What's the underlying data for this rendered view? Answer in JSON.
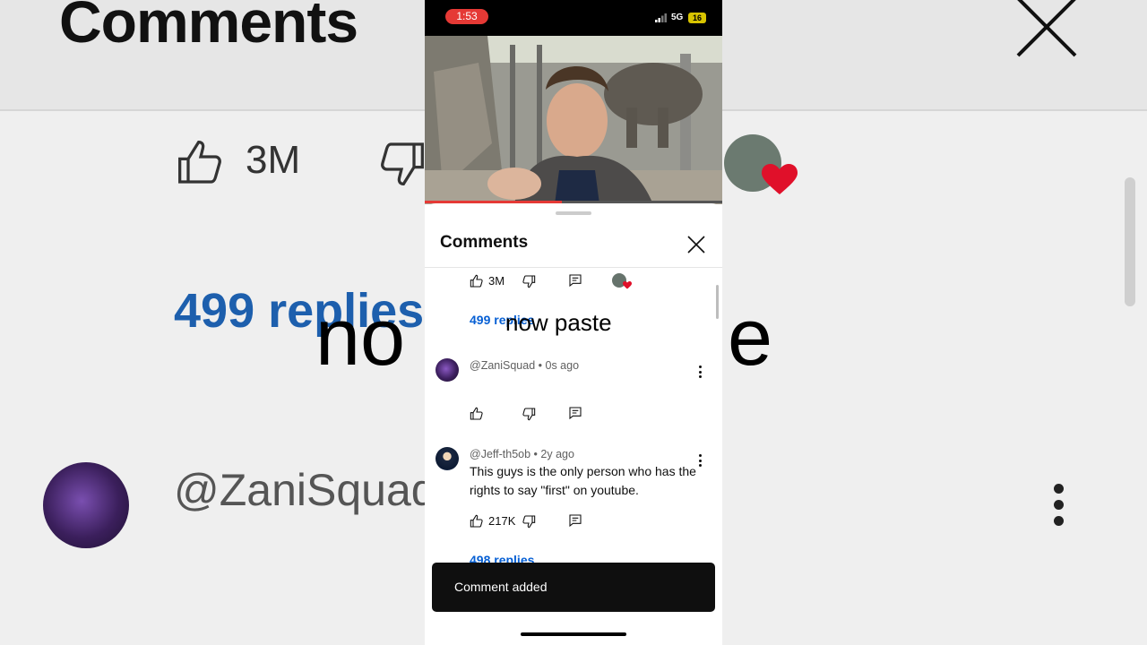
{
  "background": {
    "title": "Comments",
    "like_count": "3M",
    "replies_link": "499 replies",
    "overlay_fragment": "no",
    "overlay_tail": "e",
    "username": "@ZaniSquad"
  },
  "status_bar": {
    "time": "1:53",
    "network": "5G",
    "battery": "16"
  },
  "video": {
    "progress_fraction": 0.46
  },
  "sheet": {
    "title": "Comments",
    "close_icon": "close-icon"
  },
  "pinned_actions": {
    "like_count": "3M",
    "replies_link": "499 replies"
  },
  "overlay_caption": "now paste",
  "comments": [
    {
      "handle": "@ZaniSquad",
      "age": "0s ago",
      "body": "",
      "like_count": "",
      "avatar_color": "#3c1f5e"
    },
    {
      "handle": "@Jeff-th5ob",
      "age": "2y ago",
      "body": "This guys is the only person who has the rights to say \"first\" on youtube.",
      "like_count": "217K",
      "replies_link": "498 replies",
      "avatar_color": "#0c1a33"
    }
  ],
  "toast": {
    "message": "Comment added"
  },
  "colors": {
    "accent_red": "#e53935",
    "link_blue": "#065fd4",
    "heart_red": "#e0102a"
  }
}
